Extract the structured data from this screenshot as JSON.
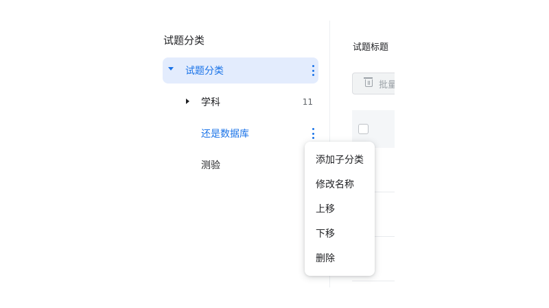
{
  "sidebar": {
    "title": "试题分类",
    "tree": {
      "root": {
        "label": "试题分类",
        "expanded": true,
        "selected": true
      },
      "subject": {
        "label": "学科",
        "count": "11",
        "expanded": false
      },
      "database": {
        "label": "还是数据库"
      },
      "quiz": {
        "label": "测验"
      }
    }
  },
  "main": {
    "column_title": "试题标题",
    "batch_button": {
      "label": "批量",
      "icon": "trash-icon"
    }
  },
  "context_menu": {
    "items": [
      "添加子分类",
      "修改名称",
      "上移",
      "下移",
      "删除"
    ]
  },
  "colors": {
    "accent": "#1a73e8",
    "selected_bg": "#e3ecfd"
  }
}
